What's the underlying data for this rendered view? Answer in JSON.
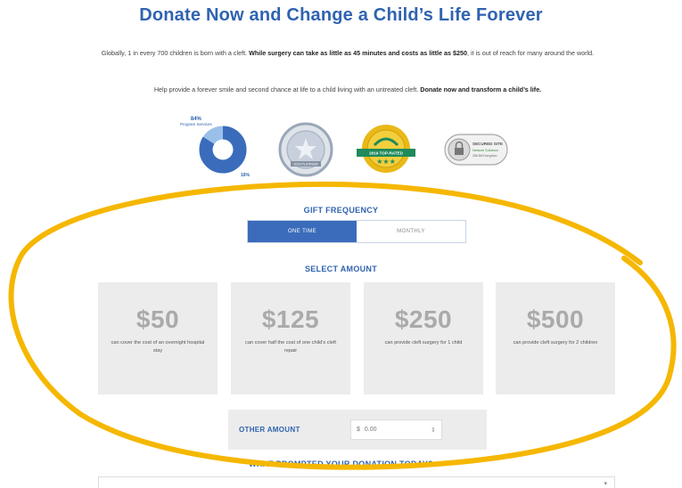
{
  "header": {
    "title": "Donate Now and Change a Child’s Life Forever"
  },
  "intro": {
    "p1_a": "Globally, 1 in every 700 children is born with a cleft. ",
    "p1_b": "While surgery can take as little as 45 minutes and costs as little as $250",
    "p1_c": ", it is out of reach for many around the world.",
    "p2_a": "Help provide a forever smile and second chance at life to a child living with an untreated cleft. ",
    "p2_b": "Donate now and transform a child’s life."
  },
  "badges": {
    "donut": {
      "top_pct": "84%",
      "top_label": "Program Services",
      "bottom_pct": "16%",
      "program_fraction": 0.84
    },
    "guidestar": {
      "icon": "guidestar-seal-icon",
      "year_label": "2019 PLATINUM",
      "colors": {
        "ring": "#9aa7b8",
        "inner": "#c7d0dc"
      }
    },
    "charity_navigator": {
      "icon": "top-rated-seal-icon",
      "label": "2019 TOP-RATED",
      "colors": {
        "gold": "#e8b917",
        "green": "#1f8a5a"
      }
    },
    "secure": {
      "icon": "secured-site-icon",
      "title": "SECURED SITE",
      "line2": "Network Solutions",
      "line3": "256 Bit Encryption"
    }
  },
  "gift_frequency": {
    "heading": "GIFT FREQUENCY",
    "options": [
      {
        "label": "ONE TIME",
        "active": true
      },
      {
        "label": "MONTHLY",
        "active": false
      }
    ]
  },
  "select_amount": {
    "heading": "SELECT AMOUNT",
    "cards": [
      {
        "amount": "$50",
        "desc": "can cover the cost of an overnight hospital stay"
      },
      {
        "amount": "$125",
        "desc": "can cover half the cost of one child’s cleft repair"
      },
      {
        "amount": "$250",
        "desc": "can provide cleft surgery for 1 child"
      },
      {
        "amount": "$500",
        "desc": "can provide cleft surgery for 2 children"
      }
    ]
  },
  "other_amount": {
    "label": "OTHER AMOUNT",
    "currency": "$",
    "value": "0.00"
  },
  "prompt": {
    "heading": "WHAT PROMPTED YOUR DONATION TODAY?"
  },
  "colors": {
    "brand_blue": "#2f63b0",
    "active_blue": "#3a6cbb",
    "card_gray": "#ececec",
    "annotation_yellow": "#f5b700"
  }
}
